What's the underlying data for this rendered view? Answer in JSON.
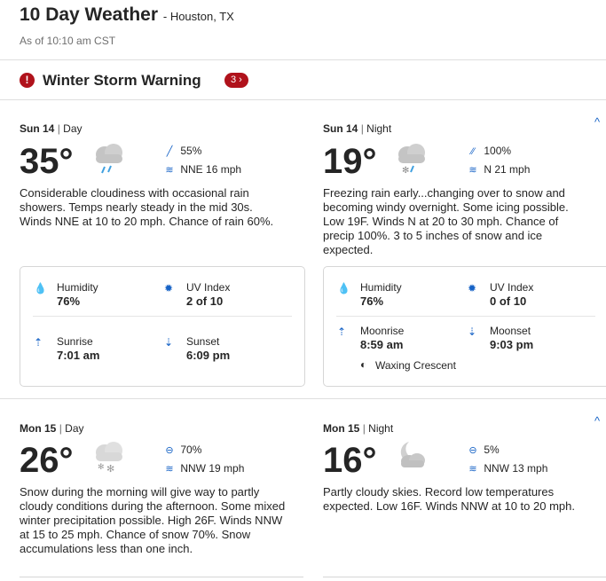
{
  "header": {
    "title": "10 Day Weather",
    "location": "- Houston, TX",
    "as_of": "As of 10:10 am CST"
  },
  "alert": {
    "icon": "!",
    "text": "Winter Storm Warning",
    "badge": "3 ›"
  },
  "icons": {
    "collapse": "^",
    "humidity": "humidity-icon",
    "uv": "uv-index-icon",
    "sunrise": "sunrise-icon",
    "sunset": "sunset-icon",
    "moonrise": "moonrise-icon",
    "moonset": "moonset-icon",
    "moon_phase": "waxing-crescent-icon",
    "rain_drop": "rain-drop-icon",
    "wind": "wind-icon"
  },
  "days": [
    {
      "day": {
        "date": "Sun 14",
        "period": "Day",
        "temp": "35°",
        "precip": "55%",
        "wind": "NNE 16 mph",
        "desc": "Considerable cloudiness with occasional rain showers. Temps nearly steady in the mid 30s. Winds NNE at 10 to 20 mph. Chance of rain 60%.",
        "humidity_label": "Humidity",
        "humidity": "76%",
        "uv_label": "UV Index",
        "uv": "2 of 10",
        "rise_label": "Sunrise",
        "rise": "7:01 am",
        "set_label": "Sunset",
        "set": "6:09 pm"
      },
      "night": {
        "date": "Sun 14",
        "period": "Night",
        "temp": "19°",
        "precip": "100%",
        "wind": "N 21 mph",
        "desc": "Freezing rain early...changing over to snow and becoming windy overnight. Some icing possible. Low 19F. Winds N at 20 to 30 mph. Chance of precip 100%. 3 to 5 inches of snow and ice expected.",
        "humidity_label": "Humidity",
        "humidity": "76%",
        "uv_label": "UV Index",
        "uv": "0 of 10",
        "rise_label": "Moonrise",
        "rise": "8:59 am",
        "set_label": "Moonset",
        "set": "9:03 pm",
        "moon_phase": "Waxing Crescent"
      }
    },
    {
      "day": {
        "date": "Mon 15",
        "period": "Day",
        "temp": "26°",
        "precip": "70%",
        "wind": "NNW 19 mph",
        "desc": "Snow during the morning will give way to partly cloudy conditions during the afternoon. Some mixed winter precipitation possible. High 26F. Winds NNW at 15 to 25 mph. Chance of snow 70%. Snow accumulations less than one inch."
      },
      "night": {
        "date": "Mon 15",
        "period": "Night",
        "temp": "16°",
        "precip": "5%",
        "wind": "NNW 13 mph",
        "desc": "Partly cloudy skies. Record low temperatures expected. Low 16F. Winds NNW at 10 to 20 mph."
      }
    }
  ]
}
